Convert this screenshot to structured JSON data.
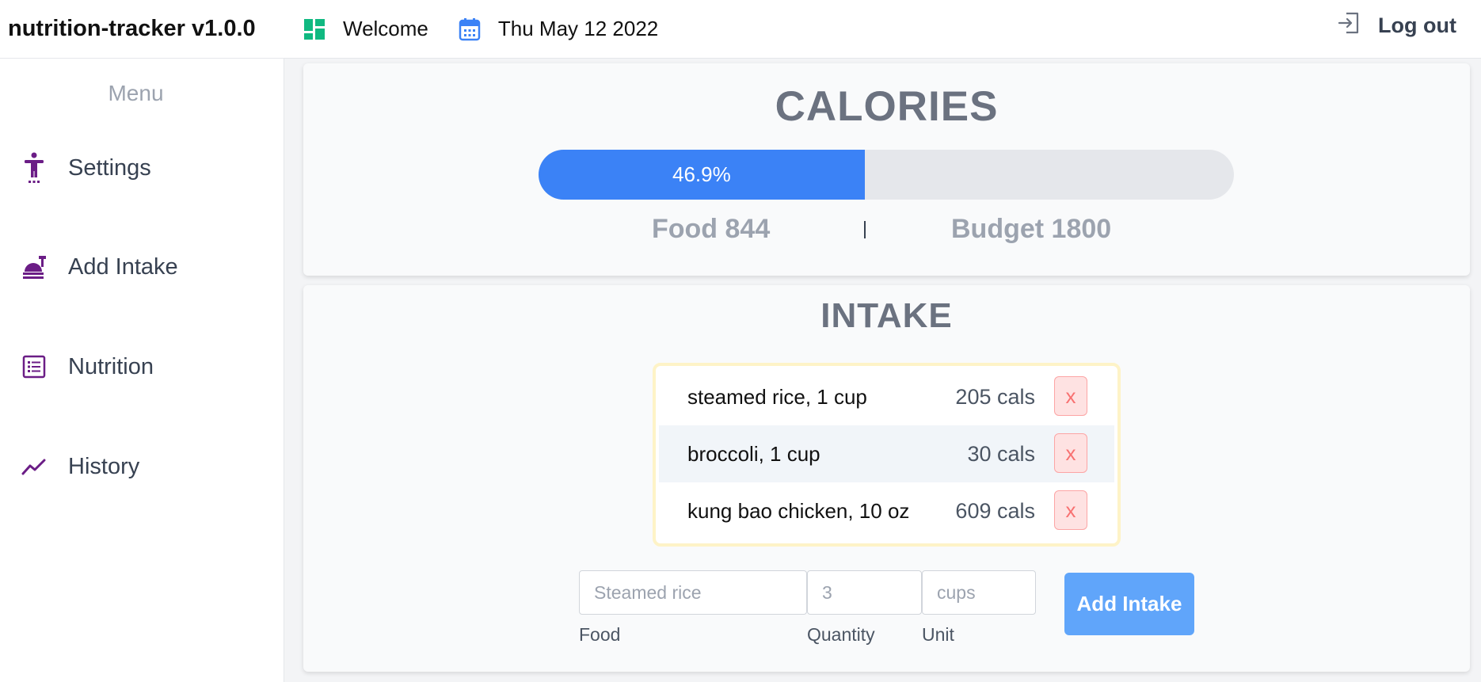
{
  "app": {
    "title": "nutrition-tracker v1.0.0"
  },
  "topbar": {
    "welcome_label": "Welcome",
    "date_label": "Thu May 12 2022",
    "logout_label": "Log out"
  },
  "sidebar": {
    "menu_title": "Menu",
    "items": [
      {
        "label": "Settings",
        "icon": "person-standing-icon"
      },
      {
        "label": "Add Intake",
        "icon": "food-plate-icon"
      },
      {
        "label": "Nutrition",
        "icon": "list-icon"
      },
      {
        "label": "History",
        "icon": "trend-line-icon"
      }
    ]
  },
  "calories": {
    "title": "CALORIES",
    "percent_text": "46.9%",
    "percent_value": 46.9,
    "food_label": "Food 844",
    "budget_label": "Budget 1800"
  },
  "intake": {
    "title": "INTAKE",
    "items": [
      {
        "food": "steamed rice, 1 cup",
        "cals": "205 cals",
        "remove": "x"
      },
      {
        "food": "broccoli, 1 cup",
        "cals": "30 cals",
        "remove": "x"
      },
      {
        "food": "kung bao chicken, 10 oz",
        "cals": "609 cals",
        "remove": "x"
      }
    ],
    "form": {
      "food_placeholder": "Steamed rice",
      "quantity_placeholder": "3",
      "unit_placeholder": "cups",
      "food_label": "Food",
      "quantity_label": "Quantity",
      "unit_label": "Unit",
      "submit_label": "Add Intake"
    }
  },
  "colors": {
    "accent_blue": "#3b82f6",
    "icon_purple": "#6b1d86",
    "grid_green": "#10b981",
    "calendar_blue": "#3b82f6",
    "remove_red": "#f87171"
  }
}
